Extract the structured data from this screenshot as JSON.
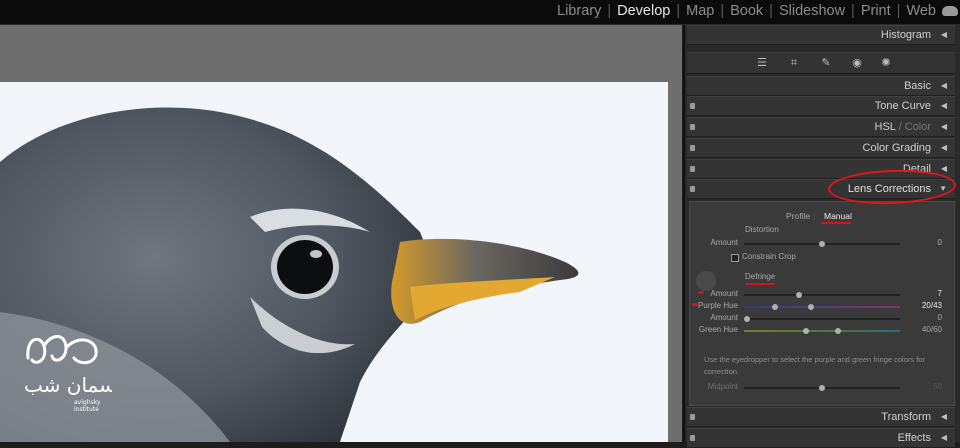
{
  "modules": [
    {
      "label": "Library",
      "active": false
    },
    {
      "label": "Develop",
      "active": true
    },
    {
      "label": "Map",
      "active": false
    },
    {
      "label": "Book",
      "active": false
    },
    {
      "label": "Slideshow",
      "active": false
    },
    {
      "label": "Print",
      "active": false
    },
    {
      "label": "Web",
      "active": false
    }
  ],
  "panel": {
    "histogram": "Histogram",
    "basic": "Basic",
    "tone_curve": "Tone Curve",
    "hsl": "HSL",
    "hsl_sep": " / ",
    "color": "Color",
    "color_grading": "Color Grading",
    "detail": "Detail",
    "lens_corrections": "Lens Corrections",
    "transform": "Transform",
    "effects": "Effects"
  },
  "lens": {
    "tabs": {
      "profile": "Profile",
      "manual": "Manual"
    },
    "distortion": {
      "heading": "Distortion",
      "amount_label": "Amount",
      "amount_value": "0",
      "amount_fraction": 0.5,
      "constrain_crop": "Constrain Crop"
    },
    "defringe": {
      "heading": "Defringe",
      "purple_amount_label": "Amount",
      "purple_amount_value": "7",
      "purple_amount_fraction": 0.35,
      "purple_hue_label": "Purple Hue",
      "purple_hue_value": "20/43",
      "purple_hue_fractions": [
        0.2,
        0.43
      ],
      "green_amount_label": "Amount",
      "green_amount_value": "0",
      "green_amount_fraction": 0.02,
      "green_hue_label": "Green Hue",
      "green_hue_value": "40/60",
      "green_hue_fractions": [
        0.4,
        0.6
      ]
    },
    "help_text": "Use the eyedropper to select the purple and green fringe colors for correction.",
    "midpoint_label": "Midpoint",
    "midpoint_value": "50",
    "midpoint_fraction": 0.5
  },
  "watermark": {
    "text": "آسمان شب",
    "sub1": "avighsky",
    "sub2": "institute"
  },
  "colors": {
    "annotation_red": "#d4141b",
    "panel_bg": "#2a2a2a",
    "photo_bg": "#f2f6fb"
  }
}
